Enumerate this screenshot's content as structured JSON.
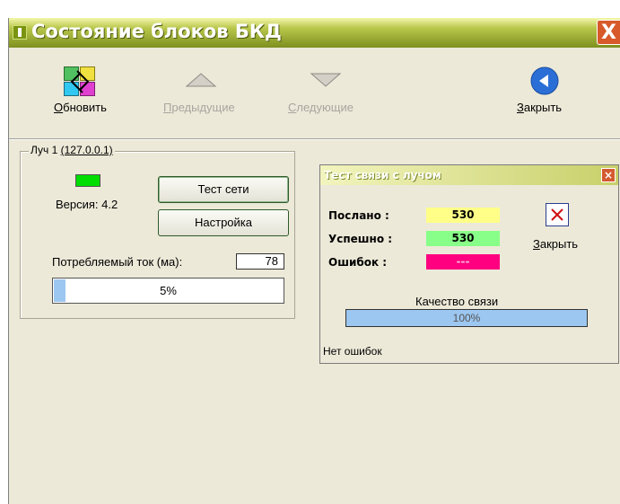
{
  "window": {
    "title": "Состояние блоков БКД",
    "close_glyph": "X"
  },
  "toolbar": {
    "refresh": {
      "label": "Обновить",
      "accel": "О",
      "rest": "бновить",
      "icon": "refresh-icon"
    },
    "previous": {
      "label": "Предыдущие",
      "accel": "П",
      "rest": "редыдущие",
      "icon": "triangle-up-icon",
      "enabled": false
    },
    "next": {
      "label": "Следующие",
      "accel": "С",
      "rest": "ледующие",
      "icon": "triangle-down-icon",
      "enabled": false
    },
    "close": {
      "label": "Закрыть",
      "accel": "З",
      "rest": "акрыть",
      "icon": "back-arrow-icon"
    }
  },
  "beam": {
    "legend": "Луч 1",
    "address": "(127.0.0.1)",
    "status_color": "#00dd00",
    "version_text": "Версия: 4.2",
    "test_button": "Тест сети",
    "settings_button": "Настройка",
    "current_label": "Потребляемый ток (ма):",
    "current_value": "78",
    "progress_text": "5%",
    "progress_value": 0.05
  },
  "dialog": {
    "title": "Тест связи с лучом",
    "close_glyph": "×",
    "rows": [
      {
        "label": "Послано :",
        "value": "530",
        "color": "#ffff88"
      },
      {
        "label": "Успешно :",
        "value": "530",
        "color": "#88ff88"
      },
      {
        "label": "Ошибок :",
        "value": "---",
        "color": "#ff0080"
      }
    ],
    "close_button": {
      "label": "Закрыть",
      "accel": "З",
      "rest": "акрыть",
      "icon": "x-mark-icon"
    },
    "quality_label": "Качество связи",
    "quality_text": "100%",
    "quality_value": 1.0,
    "status_text": "Нет ошибок"
  }
}
